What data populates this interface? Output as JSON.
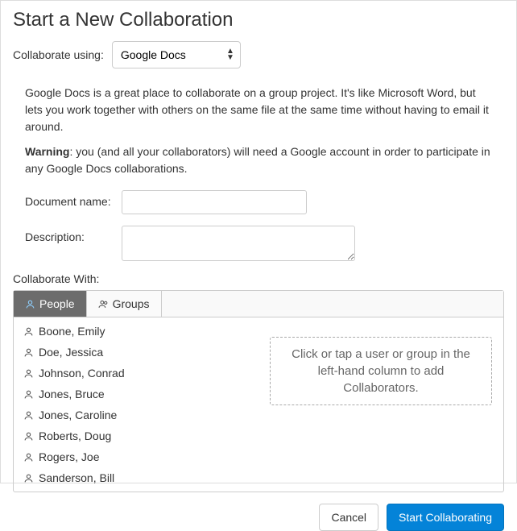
{
  "title": "Start a New Collaboration",
  "using": {
    "label": "Collaborate using:",
    "selected": "Google Docs"
  },
  "intro": {
    "text": "Google Docs is a great place to collaborate on a group project. It's like Microsoft Word, but lets you work together with others on the same file at the same time without having to email it around.",
    "warning_label": "Warning",
    "warning_text": ": you (and all your collaborators) will need a Google account in order to participate in any Google Docs collaborations."
  },
  "fields": {
    "doc_name_label": "Document name:",
    "doc_name_value": "",
    "description_label": "Description:",
    "description_value": ""
  },
  "collab": {
    "label": "Collaborate With:",
    "tabs": {
      "people": "People",
      "groups": "Groups"
    },
    "people": [
      "Boone, Emily",
      "Doe, Jessica",
      "Johnson, Conrad",
      "Jones, Bruce",
      "Jones, Caroline",
      "Roberts, Doug",
      "Rogers, Joe",
      "Sanderson, Bill"
    ],
    "hint": "Click or tap a user or group in the left-hand column to add Collaborators."
  },
  "footer": {
    "cancel": "Cancel",
    "start": "Start Collaborating"
  }
}
